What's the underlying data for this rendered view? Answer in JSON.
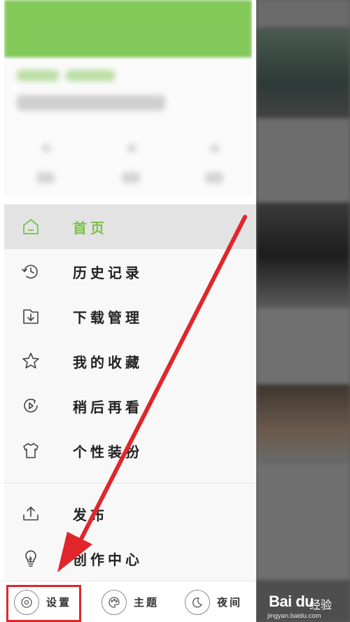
{
  "menu": {
    "items": [
      {
        "label": "首页",
        "icon": "home-icon",
        "active": true
      },
      {
        "label": "历史记录",
        "icon": "history-icon",
        "active": false
      },
      {
        "label": "下载管理",
        "icon": "download-icon",
        "active": false
      },
      {
        "label": "我的收藏",
        "icon": "star-icon",
        "active": false
      },
      {
        "label": "稍后再看",
        "icon": "watch-later-icon",
        "active": false
      },
      {
        "label": "个性装扮",
        "icon": "tshirt-icon",
        "active": false
      },
      {
        "label": "发布",
        "icon": "upload-icon",
        "active": false
      },
      {
        "label": "创作中心",
        "icon": "lightbulb-icon",
        "active": false
      }
    ]
  },
  "bottom_bar": {
    "settings_label": "设置",
    "theme_label": "主题",
    "night_label": "夜间"
  },
  "colors": {
    "accent": "#7cc04b",
    "annotation": "#e0262b"
  },
  "watermark": {
    "logo": "Bai du",
    "label": "经验",
    "url": "jingyan.baidu.com"
  }
}
